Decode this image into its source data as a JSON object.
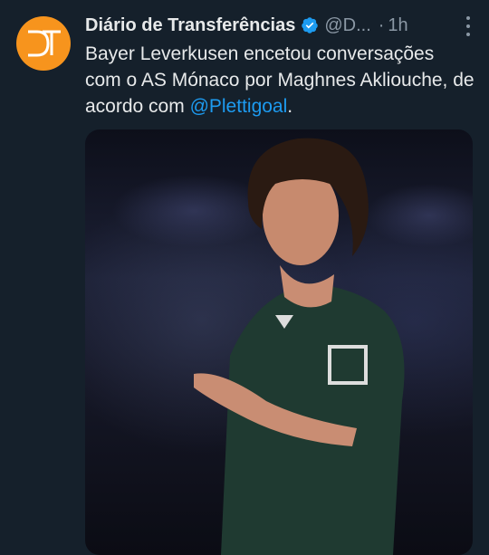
{
  "tweet": {
    "author_name": "Diário de Transferências",
    "handle": "@D...",
    "separator": "·",
    "time": "1h",
    "text_before": "Bayer Leverkusen encetou conversações com o AS Mónaco por Maghnes Akliouche, de acordo com ",
    "mention": "@Plettigoal",
    "text_after": ".",
    "avatar_text": "DT",
    "colors": {
      "background": "#15202b",
      "avatar": "#f7941d",
      "verified": "#1d9bf0",
      "link": "#1d9bf0",
      "secondary_text": "#8b98a5"
    },
    "icons": [
      "verified-badge-icon",
      "more-options-icon"
    ]
  }
}
